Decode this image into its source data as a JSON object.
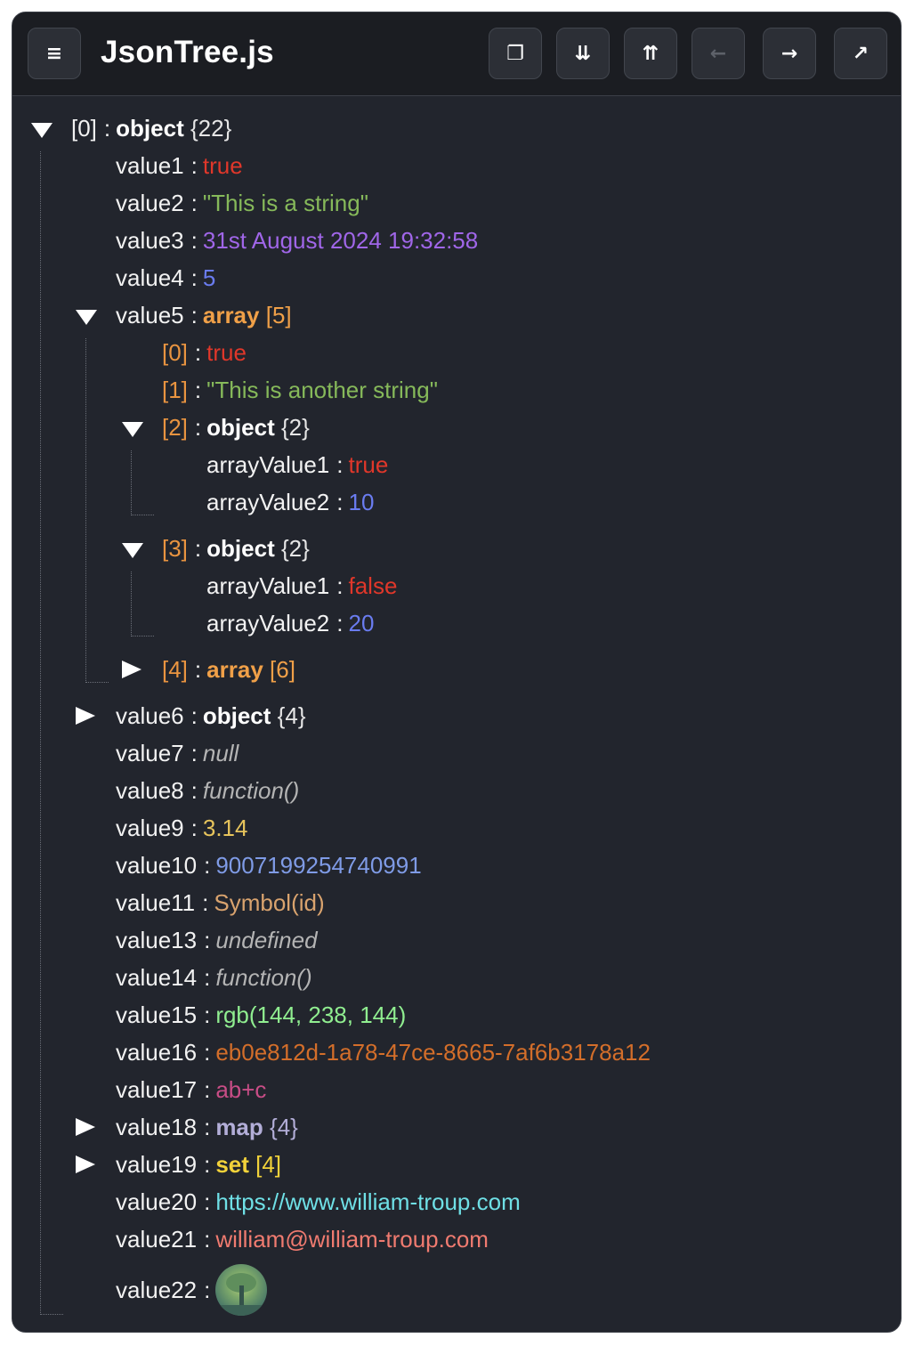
{
  "app": {
    "title": "JsonTree.js"
  },
  "toolbar": {
    "menu_icon": "≡",
    "copy_icon": "❐",
    "expand_all_icon": "⇊",
    "collapse_all_icon": "⇈",
    "back_icon": "←",
    "forward_icon": "→",
    "open_icon": "↗"
  },
  "tree": {
    "root": {
      "key": "[0]",
      "type": "object",
      "count": "{22}"
    },
    "value1": {
      "key": "value1",
      "value": "true"
    },
    "value2": {
      "key": "value2",
      "value": "\"This is a string\""
    },
    "value3": {
      "key": "value3",
      "value": "31st August 2024 19:32:58"
    },
    "value4": {
      "key": "value4",
      "value": "5"
    },
    "value5": {
      "key": "value5",
      "type": "array",
      "count": "[5]",
      "items": {
        "i0": {
          "key": "[0]",
          "value": "true"
        },
        "i1": {
          "key": "[1]",
          "value": "\"This is another string\""
        },
        "i2": {
          "key": "[2]",
          "type": "object",
          "count": "{2}",
          "a1": {
            "key": "arrayValue1",
            "value": "true"
          },
          "a2": {
            "key": "arrayValue2",
            "value": "10"
          }
        },
        "i3": {
          "key": "[3]",
          "type": "object",
          "count": "{2}",
          "a1": {
            "key": "arrayValue1",
            "value": "false"
          },
          "a2": {
            "key": "arrayValue2",
            "value": "20"
          }
        },
        "i4": {
          "key": "[4]",
          "type": "array",
          "count": "[6]"
        }
      }
    },
    "value6": {
      "key": "value6",
      "type": "object",
      "count": "{4}"
    },
    "value7": {
      "key": "value7",
      "value": "null"
    },
    "value8": {
      "key": "value8",
      "value": "function()"
    },
    "value9": {
      "key": "value9",
      "value": "3.14"
    },
    "value10": {
      "key": "value10",
      "value": "9007199254740991"
    },
    "value11": {
      "key": "value11",
      "value": "Symbol(id)"
    },
    "value13": {
      "key": "value13",
      "value": "undefined"
    },
    "value14": {
      "key": "value14",
      "value": "function()"
    },
    "value15": {
      "key": "value15",
      "value": "rgb(144, 238, 144)"
    },
    "value16": {
      "key": "value16",
      "value": "eb0e812d-1a78-47ce-8665-7af6b3178a12"
    },
    "value17": {
      "key": "value17",
      "value": "ab+c"
    },
    "value18": {
      "key": "value18",
      "type": "map",
      "count": "{4}"
    },
    "value19": {
      "key": "value19",
      "type": "set",
      "count": "[4]"
    },
    "value20": {
      "key": "value20",
      "value": "https://www.william-troup.com"
    },
    "value21": {
      "key": "value21",
      "value": "william@william-troup.com"
    },
    "value22": {
      "key": "value22",
      "value_icon": "tree-image"
    }
  },
  "separator": ":"
}
